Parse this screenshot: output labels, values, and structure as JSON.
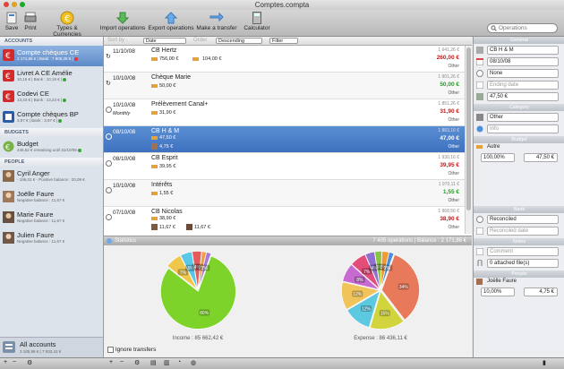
{
  "window": {
    "title": "Comptes.compta"
  },
  "toolbar": {
    "save": "Save",
    "print": "Print",
    "types": "Types & Currencies",
    "import": "Import operations",
    "export": "Export operations",
    "transfer": "Make a transfer",
    "calculator": "Calculator",
    "search_placeholder": "Operations"
  },
  "sidebar": {
    "accounts_header": "ACCOUNTS",
    "budgets_header": "BUDGETS",
    "people_header": "PEOPLE",
    "accounts": [
      {
        "name": "Compte chèques CE",
        "sub": "2 171,86 € | Bank : 7 905,28 € |"
      },
      {
        "name": "Livret A CE Amélie",
        "sub": "10,16 € | Bank : 10,16 € |"
      },
      {
        "name": "Codevi CE",
        "sub": "13,23 € | Bank : 13,23 € |"
      },
      {
        "name": "Compte chèques BP",
        "sub": "3,97 € | Bank : 3,97 € |"
      }
    ],
    "budgets": [
      {
        "name": "Budget",
        "sub": "445,52 € remaining until 31/10/08"
      }
    ],
    "people": [
      {
        "name": "Cyril Anger",
        "sub": "- 196,02 € - Positive balance : 20,09 €"
      },
      {
        "name": "Joëlle Faure",
        "sub": "Negative balance : 11,67 €"
      },
      {
        "name": "Marie Faure",
        "sub": "Negative balance : 11,67 €"
      },
      {
        "name": "Julien Faure",
        "sub": "Negative balance : 11,67 €"
      }
    ],
    "all_accounts": {
      "name": "All accounts",
      "sub": "3 185,96 € | 7 932,42 €"
    }
  },
  "filters": {
    "sort_label": "Sort by :",
    "sort_field": "Date",
    "order_label": "Order",
    "order": "Descending",
    "filter": "Filter"
  },
  "operations": [
    {
      "date": "11/10/08",
      "title": "CB Hertz",
      "a1": "756,00 €",
      "a2": "104,00 €",
      "balance": "1 641,26 €",
      "amount": "260,00 €",
      "cls": "red",
      "cat": "Other",
      "freq": ""
    },
    {
      "date": "10/10/08",
      "title": "Chèque Marie",
      "a1": "50,00 €",
      "a2": "",
      "balance": "1 901,26 €",
      "amount": "50,00 €",
      "cls": "green",
      "cat": "Other",
      "freq": ""
    },
    {
      "date": "10/10/08",
      "title": "Prélèvement Canal+",
      "a1": "31,90 €",
      "a2": "",
      "balance": "1 851,26 €",
      "amount": "31,90 €",
      "cls": "red",
      "cat": "Other",
      "freq": "Monthly"
    },
    {
      "date": "08/10/08",
      "title": "CB H & M",
      "a1": "47,50 €",
      "a2": "",
      "balance": "1 883,16 €",
      "amount": "47,00 €",
      "cls": "",
      "cat": "Other",
      "freq": "",
      "extra": "4,75 €"
    },
    {
      "date": "08/10/08",
      "title": "CB Esprit",
      "a1": "39,95 €",
      "a2": "",
      "balance": "1 930,16 €",
      "amount": "39,95 €",
      "cls": "red",
      "cat": "Other",
      "freq": ""
    },
    {
      "date": "10/10/08",
      "title": "Intérêts",
      "a1": "1,55 €",
      "a2": "",
      "balance": "1 970,11 €",
      "amount": "1,55 €",
      "cls": "green",
      "cat": "Other",
      "freq": ""
    },
    {
      "date": "07/10/08",
      "title": "CB Nicolas",
      "a1": "38,90 €",
      "a2": "",
      "balance": "1 968,56 €",
      "amount": "38,90 €",
      "cls": "red",
      "cat": "Other",
      "freq": "",
      "extra": "11,67 €",
      "extra2": "11,67 €"
    }
  ],
  "stats": {
    "title": "Statistics",
    "summary": "7 405 operations | Balance : 2 171,86 €",
    "income_label": "Income : 85 662,42 €",
    "expense_label": "Expense : 86 436,11 €",
    "ignore_transfers": "Ignore transfers"
  },
  "chart_data": [
    {
      "type": "pie",
      "title": "Income : 85 662,42 €",
      "labels": [
        "80%",
        "7%",
        "5%",
        "4%",
        "2%",
        "2%"
      ],
      "values": [
        80,
        7,
        5,
        4,
        2,
        2
      ],
      "colors": [
        "#7ed32a",
        "#f0c74a",
        "#58c8e6",
        "#e55a5a",
        "#f0a048",
        "#a77ad6"
      ]
    },
    {
      "type": "pie",
      "title": "Expense : 86 436,11 €",
      "labels": [
        "34%",
        "15%",
        "12%",
        "12%",
        "8%",
        "7%",
        "4%",
        "3%",
        "3%",
        "2%"
      ],
      "values": [
        34,
        15,
        12,
        12,
        8,
        7,
        4,
        3,
        3,
        2
      ],
      "colors": [
        "#e8795a",
        "#d1d43c",
        "#5cc9e0",
        "#f0c45a",
        "#c76ad1",
        "#e34d7a",
        "#8f6fd2",
        "#89c540",
        "#f09a30",
        "#4a8fd8"
      ]
    }
  ],
  "details": {
    "general": "General",
    "title": "CB H & M",
    "date": "08/10/08",
    "repeat": "None",
    "ending": "Ending date",
    "amount": "47,50 €",
    "category_header": "Category",
    "category": "Other",
    "info": "Info",
    "budget_header": "Budget",
    "budget_name": "Autre",
    "budget_pct": "100,00%",
    "budget_amount": "47,50 €",
    "bank_header": "Bank",
    "reconciled": "Reconciled",
    "reconciled_date": "Reconciled date",
    "notes_header": "Notes",
    "comment": "Comment",
    "files": "0 attached file(s)",
    "people_header": "People",
    "person": "Joëlle Faure",
    "person_pct": "10,00%",
    "person_amount": "4,75 €"
  }
}
